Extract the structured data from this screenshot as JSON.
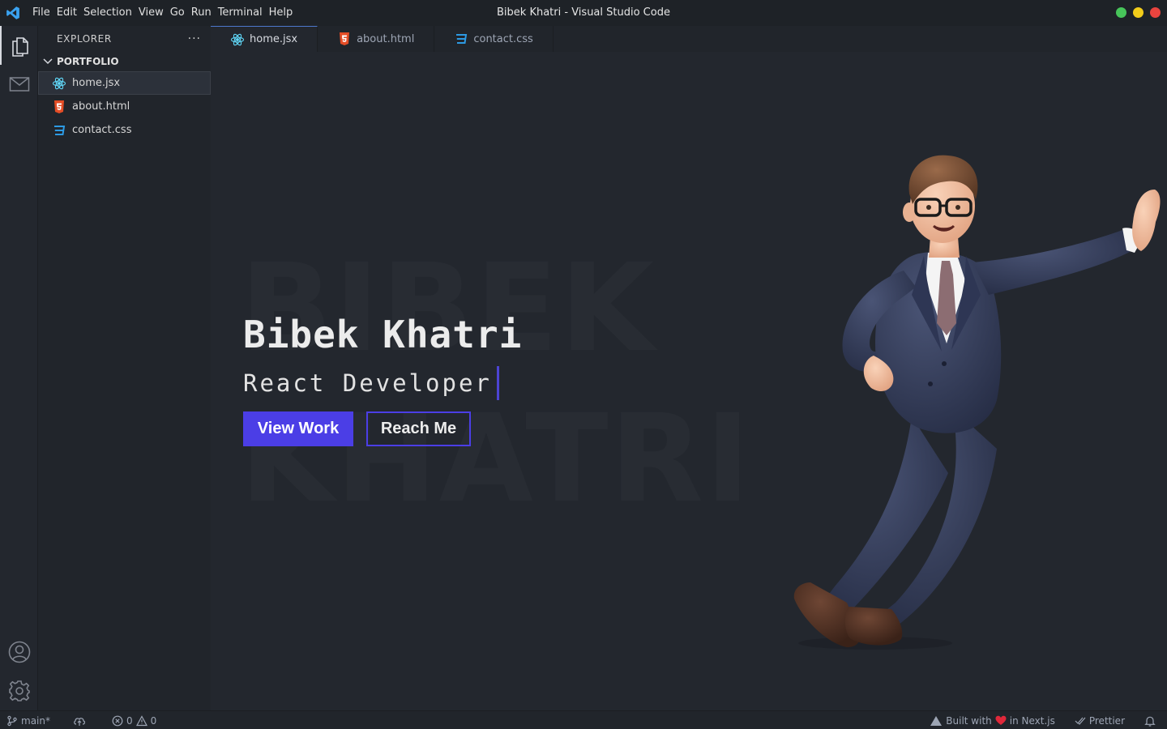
{
  "window": {
    "title": "Bibek Khatri - Visual Studio Code",
    "controls": {
      "maximize_color": "#47c55a",
      "minimize_color": "#f2cc1a",
      "close_color": "#e9443f"
    }
  },
  "menu": [
    "File",
    "Edit",
    "Selection",
    "View",
    "Go",
    "Run",
    "Terminal",
    "Help"
  ],
  "explorer": {
    "title": "EXPLORER",
    "more": "···",
    "folder": "PORTFOLIO",
    "files": [
      {
        "name": "home.jsx",
        "icon": "react-icon",
        "selected": true
      },
      {
        "name": "about.html",
        "icon": "html5-icon",
        "selected": false
      },
      {
        "name": "contact.css",
        "icon": "css3-icon",
        "selected": false
      }
    ]
  },
  "tabs": [
    {
      "label": "home.jsx",
      "icon": "react-icon",
      "active": true
    },
    {
      "label": "about.html",
      "icon": "html5-icon",
      "active": false
    },
    {
      "label": "contact.css",
      "icon": "css3-icon",
      "active": false
    }
  ],
  "hero": {
    "bg_line1": "BIBEK",
    "bg_line2": "KHATRI",
    "name": "Bibek Khatri",
    "role": "React Developer",
    "primary_button": "View Work",
    "secondary_button": "Reach Me",
    "accent_color": "#4b3ee6"
  },
  "statusbar": {
    "branch": "main*",
    "errors": "0",
    "warnings": "0",
    "built_prefix": "Built with",
    "built_suffix": "in Next.js",
    "prettier": "Prettier"
  },
  "colors": {
    "react": "#61dafb",
    "html": "#e44d26",
    "css": "#2d9ae3",
    "heart": "#e0283a"
  }
}
